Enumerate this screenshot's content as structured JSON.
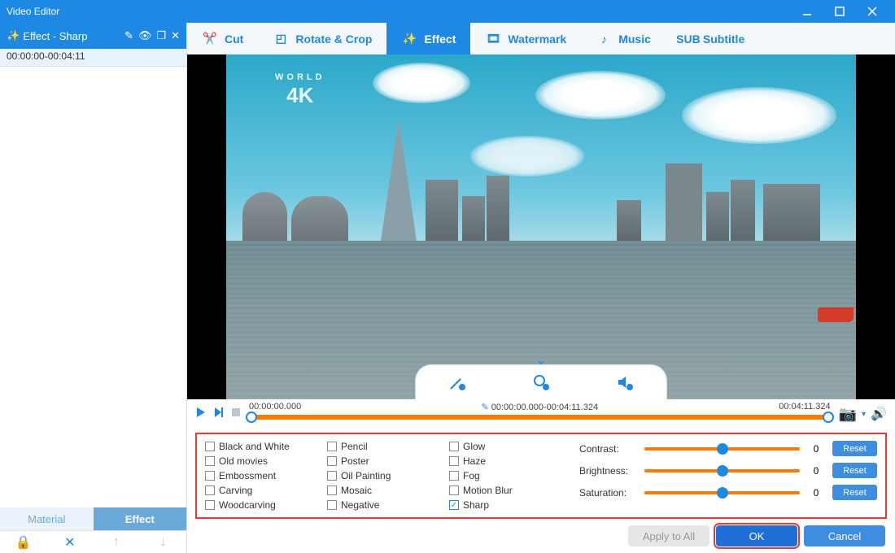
{
  "app": {
    "title": "Video Editor"
  },
  "sidebar": {
    "title": "Effect - Sharp",
    "clip_range": "00:00:00-00:04:11",
    "tabs": {
      "material": "Material",
      "effect": "Effect"
    }
  },
  "tabs": {
    "cut": "Cut",
    "rotate": "Rotate & Crop",
    "effect": "Effect",
    "watermark": "Watermark",
    "music": "Music",
    "subtitle": "Subtitle"
  },
  "preview": {
    "watermark_top": "WORLD",
    "watermark_big": "4K"
  },
  "timeline": {
    "start": "00:00:00.000",
    "mid": "00:00:00.000-00:04:11.324",
    "end": "00:04:11.324"
  },
  "effects": {
    "col1": [
      "Black and White",
      "Old movies",
      "Embossment",
      "Carving",
      "Woodcarving"
    ],
    "col2": [
      "Pencil",
      "Poster",
      "Oil Painting",
      "Mosaic",
      "Negative"
    ],
    "col3": [
      "Glow",
      "Haze",
      "Fog",
      "Motion Blur",
      "Sharp"
    ],
    "checked": "Sharp"
  },
  "adjust": {
    "contrast": {
      "label": "Contrast:",
      "value": "0",
      "reset": "Reset"
    },
    "brightness": {
      "label": "Brightness:",
      "value": "0",
      "reset": "Reset"
    },
    "saturation": {
      "label": "Saturation:",
      "value": "0",
      "reset": "Reset"
    }
  },
  "buttons": {
    "apply": "Apply to All",
    "ok": "OK",
    "cancel": "Cancel"
  }
}
